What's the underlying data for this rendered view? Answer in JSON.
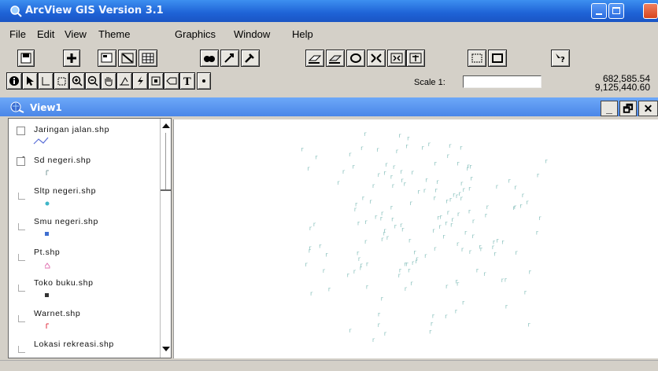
{
  "window": {
    "title": "ArcView GIS Version 3.1",
    "title_bar_color": "#1e62d6"
  },
  "menu": {
    "items": [
      "File",
      "Edit",
      "View",
      "Theme",
      "Graphics",
      "Window",
      "Help"
    ]
  },
  "toolbar1": {
    "buttons": [
      "save-icon",
      "add-theme-icon",
      "theme-properties-icon",
      "edit-legend-icon",
      "open-table-icon",
      "find-icon",
      "locate-icon",
      "query-builder-icon",
      "select-by-theme-icon",
      "select-all-icon",
      "clear-selection-icon",
      "zoom-extent-icon",
      "zoom-selected-icon",
      "zoom-in-fixed-icon",
      "zoom-out-fixed-icon",
      "help-icon"
    ]
  },
  "toolbar2": {
    "tools": [
      "identify-icon",
      "pointer-icon",
      "vertex-edit-icon",
      "select-feature-icon",
      "zoom-in-icon",
      "zoom-out-icon",
      "pan-icon",
      "measure-icon",
      "hotlink-icon",
      "area-of-interest-icon",
      "label-icon",
      "text-icon",
      "draw-point-icon"
    ],
    "scale_label": "Scale 1:",
    "scale_value": "",
    "coord_x": "682,585.54",
    "coord_y": "9,125,440.60"
  },
  "view": {
    "title": "View1",
    "title_bar_color": "#4a86e8",
    "min_label": "_",
    "restore_label": "🗗",
    "close_label": "✕"
  },
  "legend": {
    "themes": [
      {
        "name": "Jaringan jalan.shp",
        "checked": false,
        "symbol": "line",
        "color": "#5a6fd8"
      },
      {
        "name": "Sd negeri.shp",
        "checked": true,
        "symbol": "point",
        "color": "#7a9a9a"
      },
      {
        "name": "Sltp negeri.shp",
        "checked": false,
        "symbol": "dot",
        "color": "#3fb6c8"
      },
      {
        "name": "Smu negeri.shp",
        "checked": false,
        "symbol": "square",
        "color": "#3f6fd0"
      },
      {
        "name": "Pt.shp",
        "checked": false,
        "symbol": "house",
        "color": "#e070b0"
      },
      {
        "name": "Toko buku.shp",
        "checked": false,
        "symbol": "square",
        "color": "#333333"
      },
      {
        "name": "Warnet.shp",
        "checked": false,
        "symbol": "point",
        "color": "#e03040"
      },
      {
        "name": "Lokasi rekreasi.shp",
        "checked": false,
        "symbol": "none",
        "color": "#000000"
      }
    ]
  },
  "map": {
    "point_color": "#8fc4c0",
    "point_glyph": "r"
  }
}
